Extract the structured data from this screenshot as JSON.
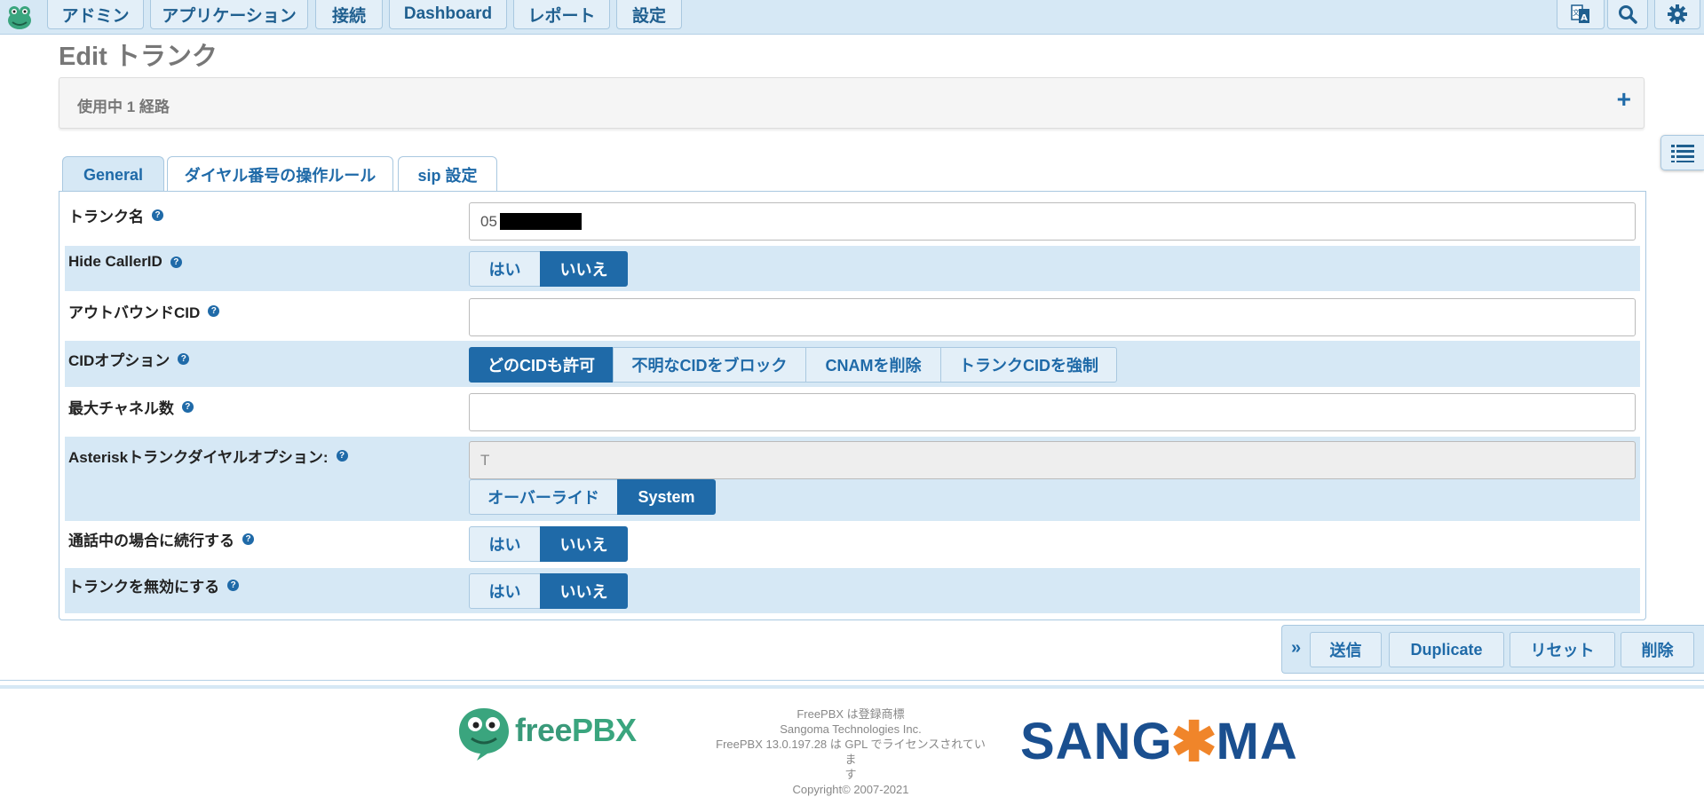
{
  "nav": {
    "items": [
      "アドミン",
      "アプリケーション",
      "接続",
      "Dashboard",
      "レポート",
      "設定"
    ]
  },
  "page": {
    "title": "Edit トランク",
    "routes_label": "使用中 1 経路",
    "routes_expand": "+"
  },
  "tabs": [
    "General",
    "ダイヤル番号の操作ルール",
    "sip 設定"
  ],
  "form": {
    "trunk_name": {
      "label": "トランク名",
      "value": "05"
    },
    "hide_callerid": {
      "label": "Hide CallerID",
      "options": [
        "はい",
        "いいえ"
      ],
      "selected": "いいえ"
    },
    "outbound_cid": {
      "label": "アウトバウンドCID",
      "value": ""
    },
    "cid_options": {
      "label": "CIDオプション",
      "options": [
        "どのCIDも許可",
        "不明なCIDをブロック",
        "CNAMを削除",
        "トランクCIDを強制"
      ],
      "selected": "どのCIDも許可"
    },
    "max_channels": {
      "label": "最大チャネル数",
      "value": ""
    },
    "dial_options": {
      "label": "Asteriskトランクダイヤルオプション:",
      "value": "T",
      "options": [
        "オーバーライド",
        "System"
      ],
      "selected": "System"
    },
    "continue_if_busy": {
      "label": "通話中の場合に続行する",
      "options": [
        "はい",
        "いいえ"
      ],
      "selected": "いいえ"
    },
    "disable_trunk": {
      "label": "トランクを無効にする",
      "options": [
        "はい",
        "いいえ"
      ],
      "selected": "いいえ"
    }
  },
  "help_glyph": "?",
  "actions": {
    "chevron": "»",
    "submit": "送信",
    "duplicate": "Duplicate",
    "reset": "リセット",
    "delete": "削除"
  },
  "footer": {
    "brand_free": "free",
    "brand_pbx": "PBX",
    "info_lines": [
      "FreePBX は登録商標",
      "Sangoma Technologies Inc.",
      "FreePBX 13.0.197.28 は GPL でライセンスされていま",
      "す",
      "Copyright© 2007-2021"
    ],
    "sangoma_left": "SANG",
    "sangoma_star": "✱",
    "sangoma_right": "MA"
  }
}
